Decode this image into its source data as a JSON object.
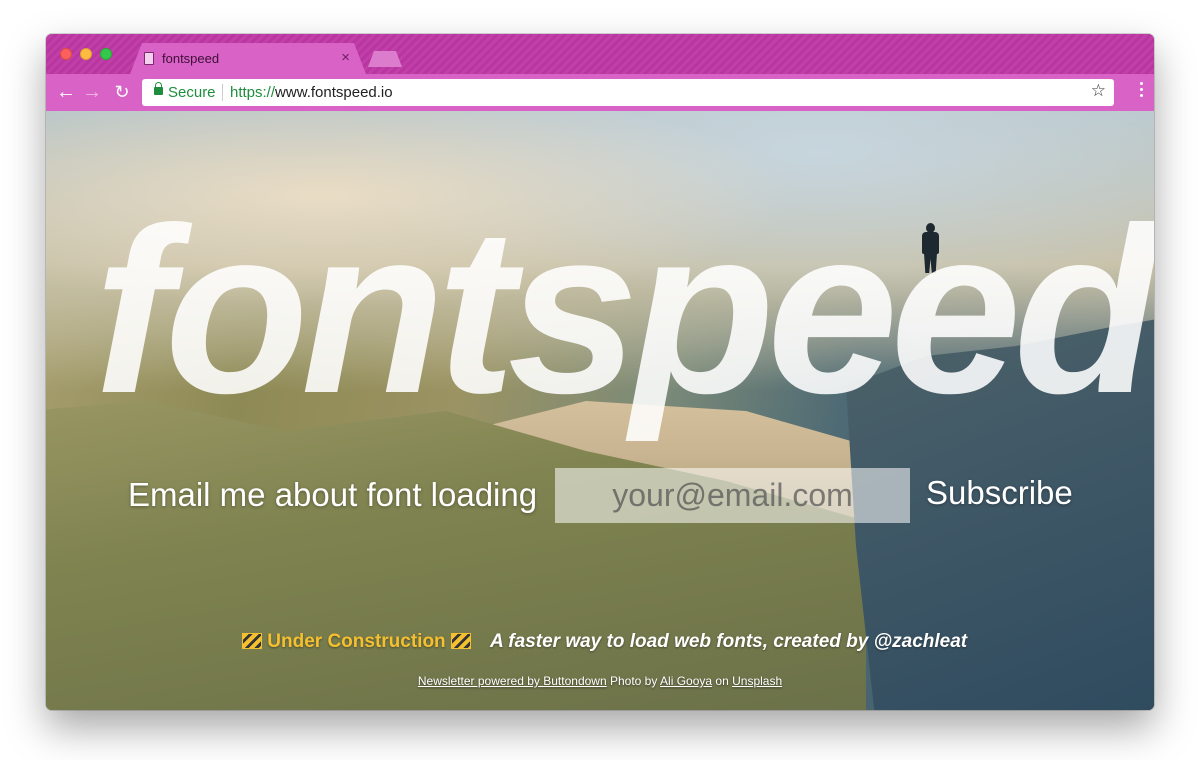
{
  "browser": {
    "tab_title": "fontspeed",
    "tab_close": "×",
    "secure_label": "Secure",
    "url_scheme": "https://",
    "url_host": "www.fontspeed.io",
    "accent_color": "#d862c6"
  },
  "page": {
    "logo_text": "fontspeed",
    "signup_label": "Email me about font loading",
    "email_placeholder": "your@email.com",
    "subscribe_label": "Subscribe",
    "construction_label": "Under Construction",
    "tagline": "A faster way to load web fonts, created by @zachleat",
    "credits": {
      "newsletter_link": "Newsletter powered by Buttondown",
      "photo_by": "Photo by",
      "photographer_link": "Ali Gooya",
      "on": "on",
      "source_link": "Unsplash"
    }
  }
}
